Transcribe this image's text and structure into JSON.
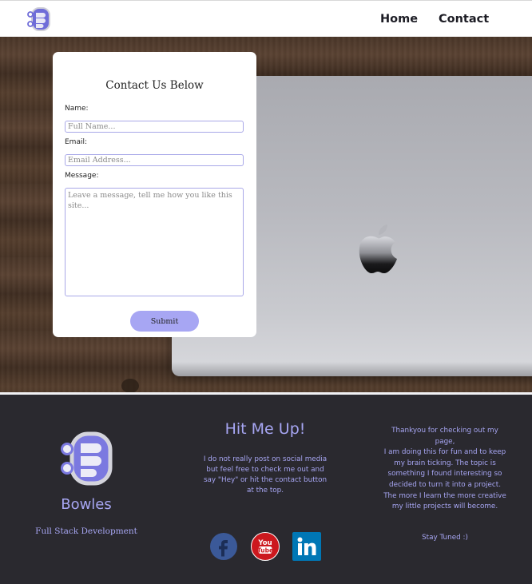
{
  "nav": {
    "logo_icon": "database-logo-icon",
    "home_label": "Home",
    "contact_label": "Contact"
  },
  "contact_form": {
    "title": "Contact Us Below",
    "name_label": "Name:",
    "name_placeholder": "Full Name...",
    "email_label": "Email:",
    "email_placeholder": "Email Address...",
    "message_label": "Message:",
    "message_placeholder": "Leave a message, tell me how you like this site...",
    "submit_label": "Submit"
  },
  "footer": {
    "brand_name": "Bowles",
    "brand_tagline": "Full Stack Development",
    "hit_title": "Hit Me Up!",
    "hit_text": "I do not really post on social media but feel free to check me out and say \"Hey\" or hit the contact button at the top.",
    "social_icons": [
      "facebook-icon",
      "youtube-icon",
      "linkedin-icon"
    ],
    "thanks_lines": [
      "Thankyou for checking out my page,",
      "I am doing this for fun and to keep my brain ticking. The topic is something I found interesting so decided to turn it into a project. The more I learn the more creative my little projects will become."
    ],
    "stay_tuned": "Stay Tuned :)"
  },
  "colors": {
    "accent": "#a7a6f3",
    "footer_bg": "#2a292f",
    "logo_fill": "#7b79e0",
    "facebook": "#3b5998",
    "youtube": "#cc181e",
    "linkedin": "#0077b5"
  }
}
